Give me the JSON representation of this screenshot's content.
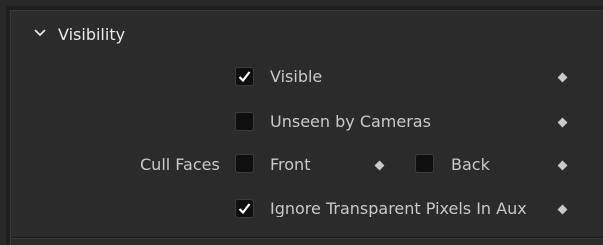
{
  "section": {
    "title": "Visibility",
    "expanded": true,
    "chevron_icon": "chevron-down-icon"
  },
  "options": {
    "visible": {
      "label": "Visible",
      "checked": true
    },
    "unseen_by_cameras": {
      "label": "Unseen by Cameras",
      "checked": false
    },
    "cull_faces": {
      "label": "Cull Faces",
      "front": {
        "label": "Front",
        "checked": false
      },
      "back": {
        "label": "Back",
        "checked": false
      }
    },
    "ignore_transparent": {
      "label": "Ignore Transparent Pixels In Aux",
      "checked": true
    }
  },
  "colors": {
    "panel_bg": "#2b2b2b",
    "checkbox_bg": "#0f0f0f",
    "text": "#c9c9c9",
    "title_text": "#e9e9e9"
  }
}
